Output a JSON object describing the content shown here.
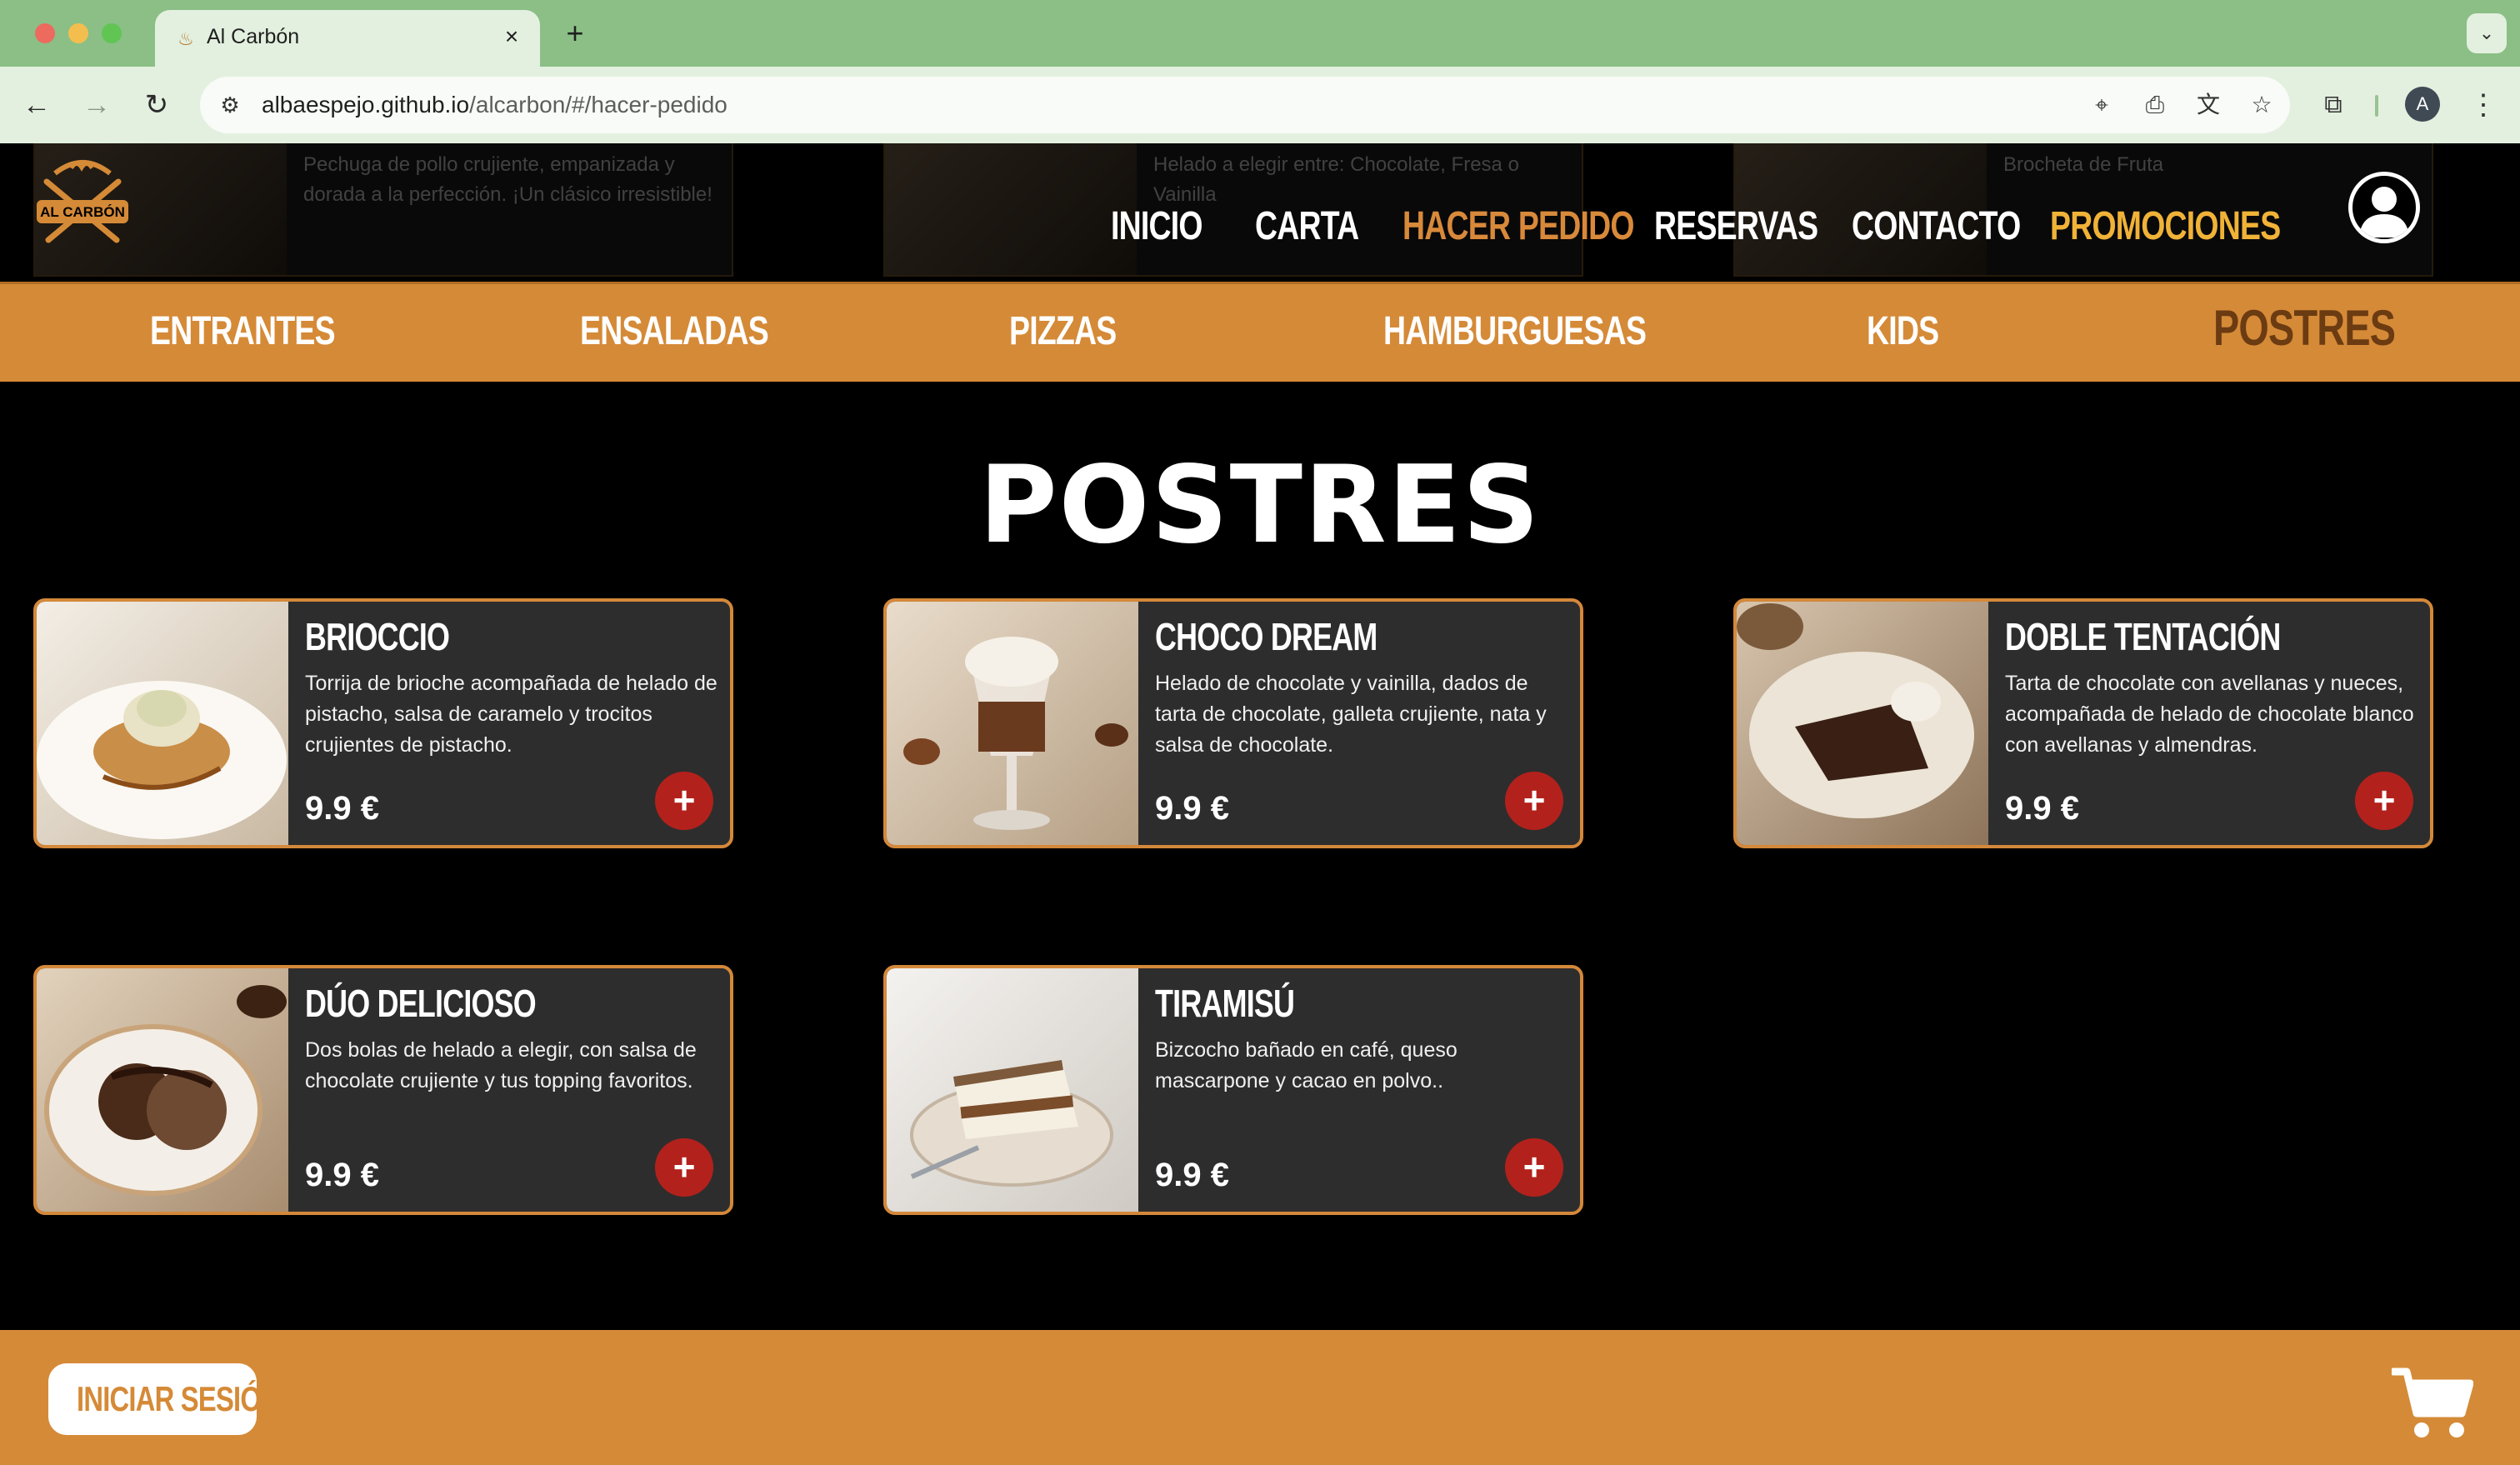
{
  "browser": {
    "tab_title": "Al Carbón",
    "url_domain": "albaespejo.github.io",
    "url_path": "/alcarbon/#/hacer-pedido",
    "profile_initial": "A"
  },
  "behind_header": [
    {
      "text": "Pechuga de pollo crujiente, empanizada y dorada a la perfección. ¡Un clásico irresistible!"
    },
    {
      "text": "Helado a elegir entre: Chocolate, Fresa o Vainilla"
    },
    {
      "text": "Brocheta de Fruta"
    }
  ],
  "nav": {
    "logo_text": "AL CARBÓN",
    "items": [
      {
        "label": "INICIO"
      },
      {
        "label": "CARTA"
      },
      {
        "label": "HACER PEDIDO"
      },
      {
        "label": "RESERVAS"
      },
      {
        "label": "CONTACTO"
      },
      {
        "label": "PROMOCIONES"
      }
    ]
  },
  "categories": [
    {
      "label": "ENTRANTES"
    },
    {
      "label": "ENSALADAS"
    },
    {
      "label": "PIZZAS"
    },
    {
      "label": "HAMBURGUESAS"
    },
    {
      "label": "KIDS"
    },
    {
      "label": "POSTRES"
    }
  ],
  "section_title": "POSTRES",
  "products": [
    {
      "name": "BRIOCCIO",
      "description": "Torrija de brioche acompañada de helado de pistacho, salsa de caramelo y trocitos crujientes de pistacho.",
      "price": "9.9 €",
      "add_label": "+"
    },
    {
      "name": "CHOCO DREAM",
      "description": "Helado de chocolate y vainilla, dados de tarta de chocolate, galleta crujiente, nata y salsa de chocolate.",
      "price": "9.9 €",
      "add_label": "+"
    },
    {
      "name": "DOBLE TENTACIÓN",
      "description": "Tarta de chocolate con avellanas y nueces, acompañada de helado de chocolate blanco con avellanas y almendras.",
      "price": "9.9 €",
      "add_label": "+"
    },
    {
      "name": "DÚO DELICIOSO",
      "description": "Dos bolas de helado a elegir, con salsa de chocolate crujiente y tus topping favoritos.",
      "price": "9.9 €",
      "add_label": "+"
    },
    {
      "name": "TIRAMISÚ",
      "description": "Bizcocho bañado en café, queso mascarpone y cacao en polvo..",
      "price": "9.9 €",
      "add_label": "+"
    }
  ],
  "footer": {
    "login_label": "INICIAR SESIÓN"
  },
  "colors": {
    "accent": "#d58a37",
    "active_nav": "#d8893a",
    "promo": "#f0b237",
    "add_button": "#b3211c",
    "card_bg": "#2e2d2d"
  },
  "icons": [
    "back-icon",
    "forward-icon",
    "reload-icon",
    "site-info-icon",
    "location-icon",
    "install-icon",
    "translate-icon",
    "star-icon",
    "extensions-icon",
    "more-icon",
    "user-icon",
    "cart-icon"
  ]
}
